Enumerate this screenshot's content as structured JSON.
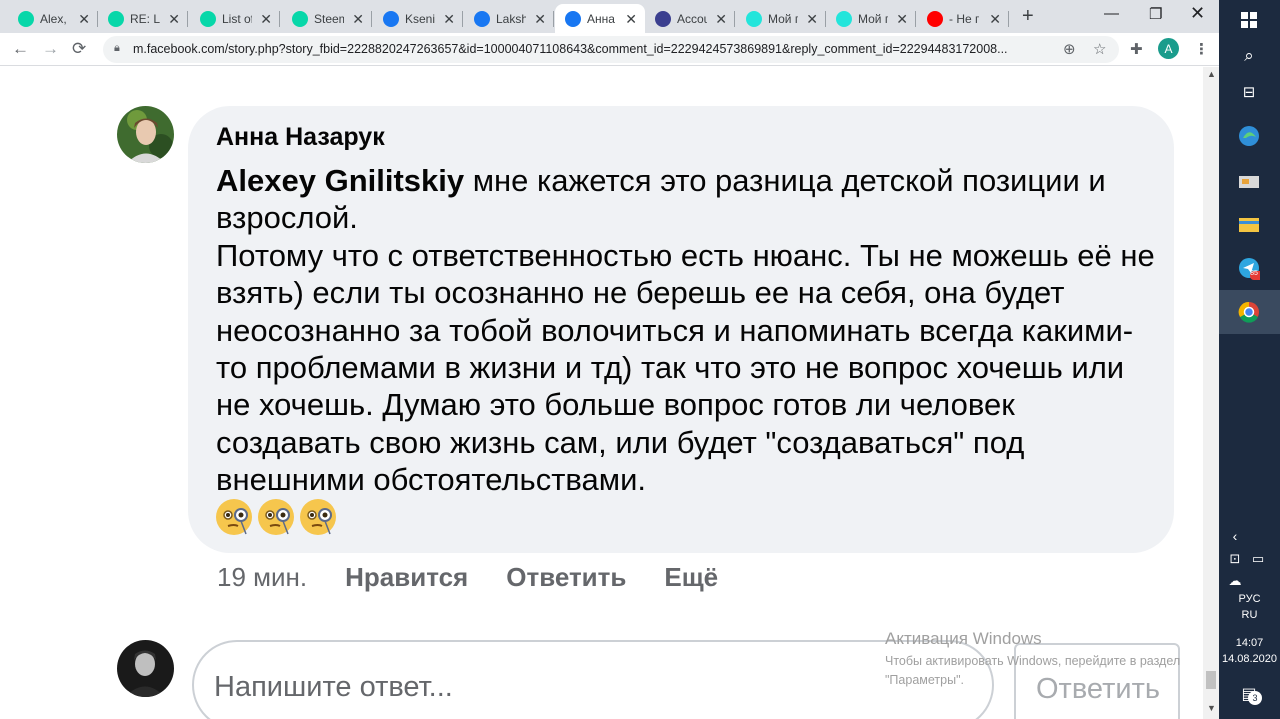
{
  "tabs": [
    {
      "title": "Alex, n",
      "icon": "steemit-icon",
      "color": "#07d7a9"
    },
    {
      "title": "RE: Lis",
      "icon": "steemit-icon",
      "color": "#07d7a9"
    },
    {
      "title": "List of",
      "icon": "steemit-icon",
      "color": "#07d7a9"
    },
    {
      "title": "Steem",
      "icon": "steemit-icon",
      "color": "#07d7a9"
    },
    {
      "title": "Ksenia",
      "icon": "facebook-icon",
      "color": "#1877f2"
    },
    {
      "title": "Lakshr",
      "icon": "facebook-icon",
      "color": "#1877f2"
    },
    {
      "title": "Анна",
      "icon": "facebook-icon",
      "color": "#1877f2",
      "active": true
    },
    {
      "title": "Accou",
      "icon": "account-icon",
      "color": "#3b3f8f"
    },
    {
      "title": "Мой п",
      "icon": "olx-icon",
      "color": "#23e5db"
    },
    {
      "title": "Мой п",
      "icon": "olx-icon",
      "color": "#23e5db"
    },
    {
      "title": "- Не п",
      "icon": "youtube-icon",
      "color": "#ff0000"
    }
  ],
  "address_bar": {
    "url": "m.facebook.com/story.php?story_fbid=2228820247263657&id=100004071108643&comment_id=2229424573869891&reply_comment_id=22294483172008..."
  },
  "profile_initial": "A",
  "comment": {
    "author": "Анна Назарук",
    "mention": "Alexey Gnilitskiy",
    "text_first": " мне кажется это разница детской позиции и взрослой.",
    "text_lines": [
      "Потому что с ответственностью есть нюанс. Ты не можешь её не взять) если ты осознанно не берешь ее на себя, она будет неосознанно за тобой волочиться и напоминать всегда какими-то проблемами в жизни и тд) так что это не вопрос хочешь или не хочешь. Думаю это больше вопрос готов ли человек создавать свою жизнь сам, или будет \"создаваться\" под внешними обстоятельствами."
    ],
    "emoji_count": 3,
    "emoji": "face-with-monocle-icon"
  },
  "comment_actions": {
    "time": "19 мин.",
    "like": "Нравится",
    "reply": "Ответить",
    "more": "Ещё"
  },
  "reply_box": {
    "placeholder": "Напишите ответ...",
    "send_label": "Ответить"
  },
  "watermark": {
    "title": "Активация Windows",
    "subtitle": "Чтобы активировать Windows, перейдите в раздел \"Параметры\"."
  },
  "taskbar": {
    "lang_primary": "РУС",
    "lang_secondary": "RU",
    "time": "14:07",
    "date": "14.08.2020",
    "notification_count": "3",
    "telegram_badge": "85"
  }
}
